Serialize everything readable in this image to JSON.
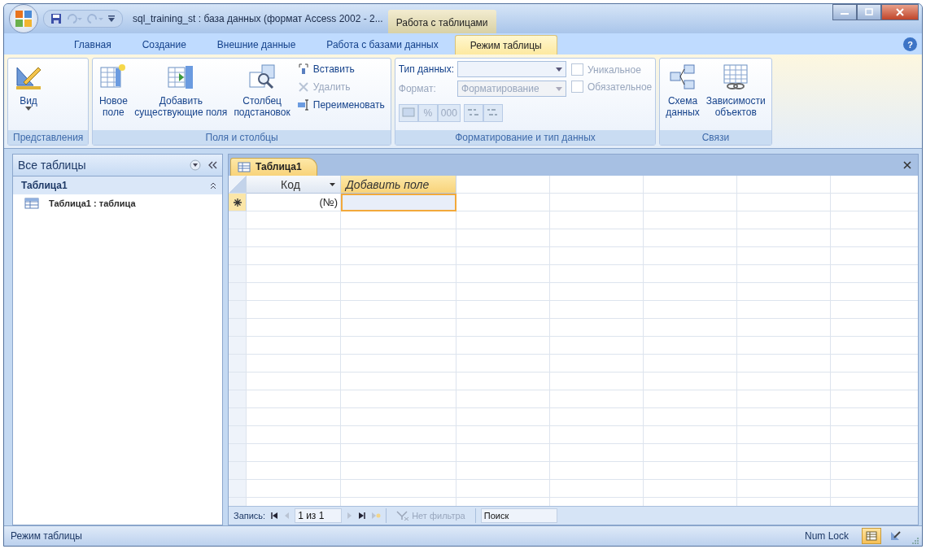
{
  "window": {
    "title": "sql_training_st : база данных (формат Access 2002 - 2...",
    "context_tab": "Работа с таблицами"
  },
  "ribbon": {
    "help": "?",
    "tabs": [
      {
        "label": "Главная",
        "selected": false
      },
      {
        "label": "Создание",
        "selected": false
      },
      {
        "label": "Внешние данные",
        "selected": false
      },
      {
        "label": "Работа с базами данных",
        "selected": false
      },
      {
        "label": "Режим таблицы",
        "selected": true
      }
    ],
    "views": {
      "title": "Представления",
      "button": {
        "lines": [
          "Вид"
        ],
        "dropdown": true
      }
    },
    "fields": {
      "title": "Поля и столбцы",
      "buttons": [
        {
          "lines": [
            "Новое",
            "поле"
          ]
        },
        {
          "lines": [
            "Добавить",
            "существующие поля"
          ]
        },
        {
          "lines": [
            "Столбец",
            "подстановок"
          ]
        }
      ],
      "small_buttons": [
        {
          "label": "Вставить",
          "disabled": false
        },
        {
          "label": "Удалить",
          "disabled": true
        },
        {
          "label": "Переименовать",
          "disabled": false
        }
      ]
    },
    "formatting": {
      "title": "Форматирование и тип данных",
      "data_type_label": "Тип данных:",
      "format_label": "Формат:",
      "format_value": "Форматирование",
      "format_disabled": true,
      "checkboxes": [
        {
          "label": "Уникальное",
          "checked": false,
          "disabled": true
        },
        {
          "label": "Обязательное",
          "checked": false,
          "disabled": true
        }
      ],
      "number_buttons": [
        "%",
        "000"
      ]
    },
    "relations": {
      "title": "Связи",
      "buttons": [
        {
          "lines": [
            "Схема",
            "данных"
          ]
        },
        {
          "lines": [
            "Зависимости",
            "объектов"
          ]
        }
      ]
    }
  },
  "nav_pane": {
    "title": "Все таблицы",
    "groups": [
      {
        "label": "Таблица1",
        "expanded": true,
        "children": [
          {
            "label": "Таблица1 : таблица"
          }
        ]
      }
    ]
  },
  "document": {
    "tab": "Таблица1",
    "columns": [
      {
        "label": "Код",
        "kind": "field"
      },
      {
        "label": "Добавить поле",
        "kind": "add"
      }
    ],
    "new_row": {
      "id_value": "(№)",
      "add_cell_selected": true
    }
  },
  "record_nav": {
    "label": "Запись:",
    "position": "1 из 1",
    "filter": "Нет фильтра",
    "filter_disabled": true,
    "search_placeholder": "Поиск"
  },
  "status_bar": {
    "text": "Режим таблицы",
    "indicator": "Num Lock",
    "views": [
      {
        "selected": true
      },
      {
        "selected": false
      }
    ]
  }
}
